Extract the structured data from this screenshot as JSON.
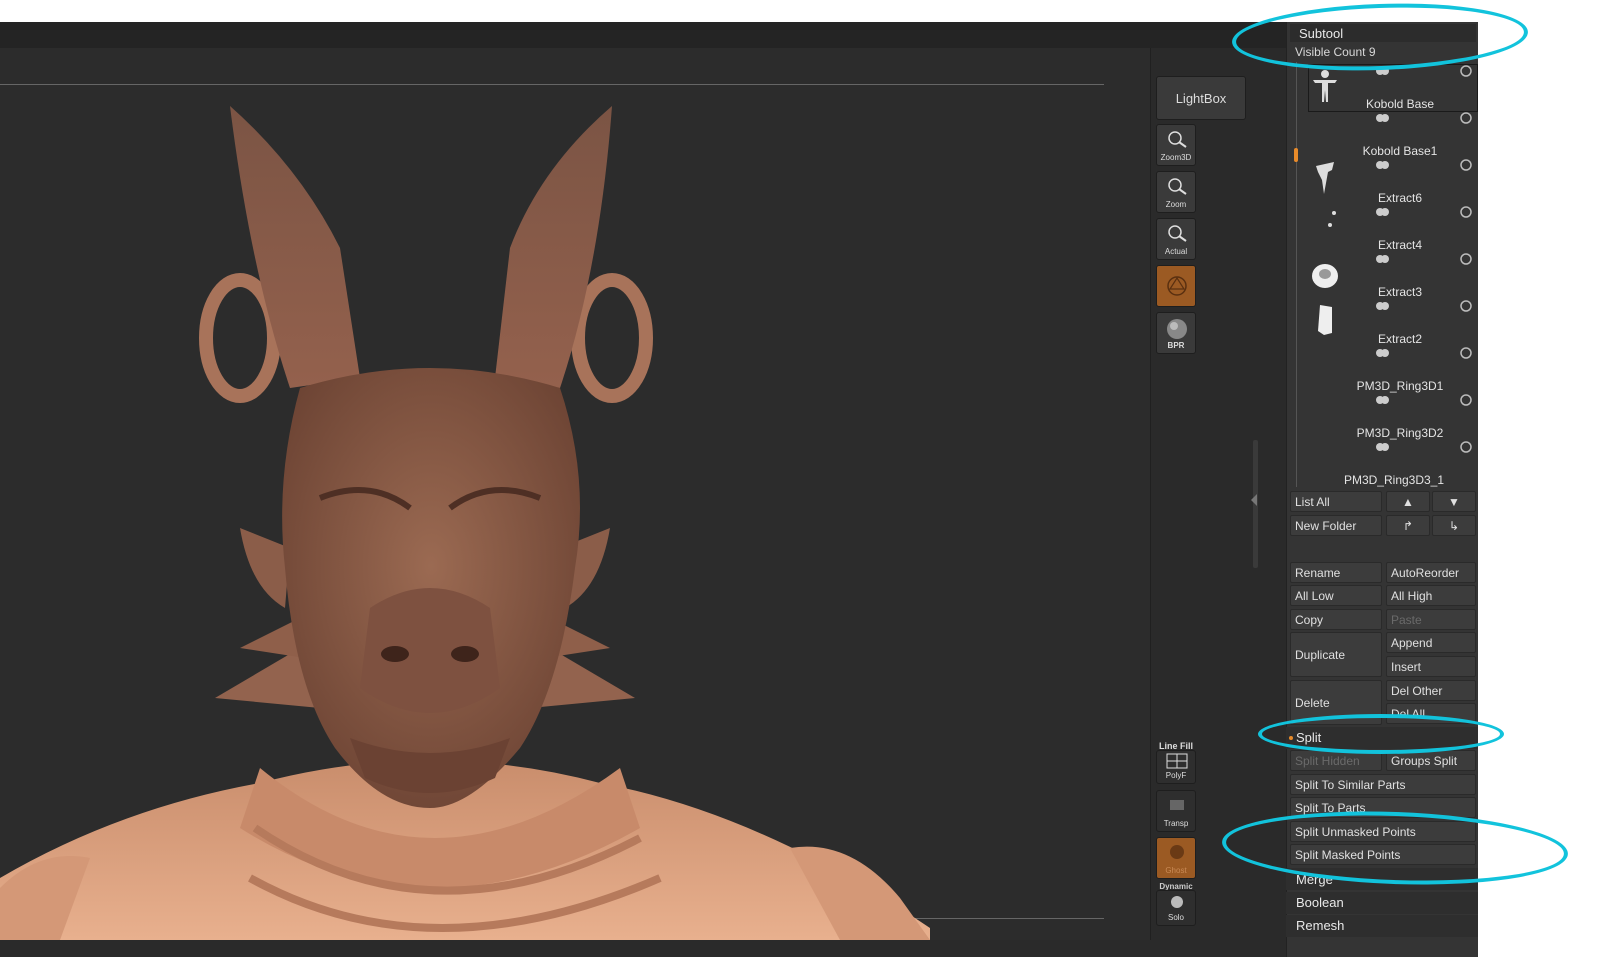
{
  "shelf": {
    "lightbox": "LightBox",
    "buttons": [
      {
        "label": "Zoom3D",
        "icon": "zoom3d-icon"
      },
      {
        "label": "Zoom",
        "icon": "zoom-icon"
      },
      {
        "label": "Actual",
        "icon": "actual-icon"
      },
      {
        "label": "",
        "icon": "camera-orange-icon"
      },
      {
        "label": "BPR",
        "icon": "bpr-sphere-icon"
      }
    ],
    "lower": [
      {
        "title": "Line Fill",
        "label": "PolyF",
        "icon": "polyframe-icon"
      },
      {
        "label": "Transp",
        "icon": "transparency-icon"
      },
      {
        "label": "Ghost",
        "icon": "ghost-icon"
      },
      {
        "title": "Dynamic",
        "label": "Solo",
        "icon": "solo-icon"
      }
    ]
  },
  "subtool": {
    "title": "Subtool",
    "visible_count": "Visible Count 9",
    "items": [
      {
        "name": "Kobold Base"
      },
      {
        "name": "Kobold Base1"
      },
      {
        "name": "Extract6"
      },
      {
        "name": "Extract4"
      },
      {
        "name": "Extract3"
      },
      {
        "name": "Extract2"
      },
      {
        "name": "PM3D_Ring3D1"
      },
      {
        "name": "PM3D_Ring3D2"
      },
      {
        "name": "PM3D_Ring3D3_1"
      }
    ],
    "list_all": "List All",
    "new_folder": "New Folder",
    "rename": "Rename",
    "auto_reorder": "AutoReorder",
    "all_low": "All Low",
    "all_high": "All High",
    "copy": "Copy",
    "paste": "Paste",
    "duplicate": "Duplicate",
    "append": "Append",
    "insert": "Insert",
    "delete": "Delete",
    "del_other": "Del Other",
    "del_all": "Del All",
    "split": "Split",
    "split_hidden": "Split Hidden",
    "groups_split": "Groups Split",
    "split_similar": "Split To Similar Parts",
    "split_parts": "Split To Parts",
    "split_unmasked": "Split Unmasked Points",
    "split_masked": "Split Masked Points",
    "merge": "Merge",
    "boolean": "Boolean",
    "remesh": "Remesh"
  },
  "colors": {
    "accent": "#e88b2a",
    "highlight": "#12c3dc",
    "clay": "#8a5a44"
  }
}
